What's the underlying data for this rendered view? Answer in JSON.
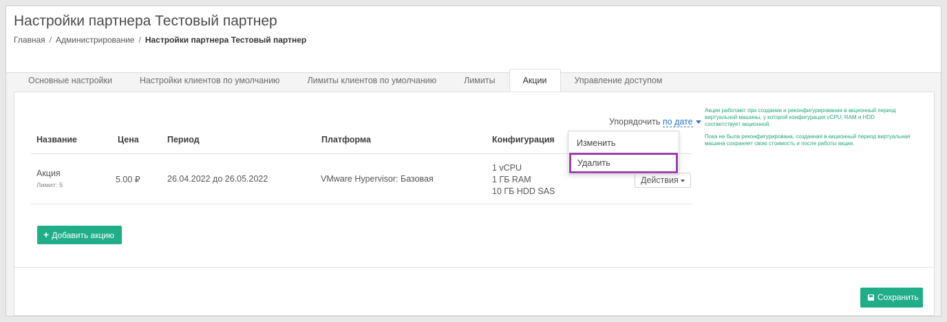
{
  "header": {
    "title": "Настройки партнера Тестовый партнер",
    "breadcrumb": {
      "home": "Главная",
      "admin": "Администрирование",
      "current": "Настройки партнера Тестовый партнер",
      "separator": "/"
    }
  },
  "tabs": [
    {
      "label": "Основные настройки",
      "active": false
    },
    {
      "label": "Настройки клиентов по умолчанию",
      "active": false
    },
    {
      "label": "Лимиты клиентов по умолчанию",
      "active": false
    },
    {
      "label": "Лимиты",
      "active": false
    },
    {
      "label": "Акции",
      "active": true
    },
    {
      "label": "Управление доступом",
      "active": false
    }
  ],
  "sort": {
    "label": "Упорядочить",
    "value": "по дате"
  },
  "table": {
    "columns": [
      "Название",
      "Цена",
      "Период",
      "Платформа",
      "Конфигурация"
    ],
    "rows": [
      {
        "name": "Акция",
        "limit": "Лимит: 5",
        "price": "5.00 ₽",
        "period": "26.04.2022 до 26.05.2022",
        "platform": "VMware Hypervisor: Базовая",
        "config": [
          "1 vCPU",
          "1 ГБ RAM",
          "10 ГБ HDD SAS"
        ],
        "actions_label": "Действия"
      }
    ]
  },
  "dropdown": {
    "edit": "Изменить",
    "delete": "Удалить",
    "highlight_color": "#9a3fa8"
  },
  "buttons": {
    "add_promo": "Добавить акцию",
    "save": "Сохранить"
  },
  "info": {
    "paragraph1": "Акции работают при создании и реконфигурировании в акционный период виртуальной машины, у которой конфигурация vCPU, RAM и HDD соответствует акционной.",
    "paragraph2": "Пока не была реконфигурирована, созданная в акционный период виртуальная машина сохраняет свою стоимость и после работы акции."
  },
  "colors": {
    "accent": "#1fae87",
    "link": "#2b73c5",
    "info_text": "#21a879"
  },
  "icons": {
    "add": "plus-icon",
    "save": "floppy-disk-icon",
    "sort": "caret-down-icon",
    "actions": "caret-down-icon"
  }
}
